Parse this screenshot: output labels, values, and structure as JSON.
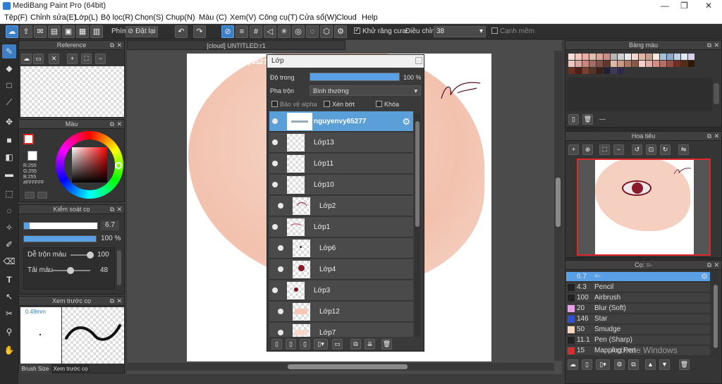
{
  "window": {
    "title": "MediBang Paint Pro (64bit)"
  },
  "menu": [
    "Tệp(F)",
    "Chỉnh sửa(E)",
    "Lớp(L)",
    "Bộ lọc(R)",
    "Chọn(S)",
    "Chụp(N)",
    "Màu (C)",
    "Xem(V)",
    "Công cụ(T)",
    "Cửa sổ(W)",
    "Cloud",
    "Help"
  ],
  "toolbar": {
    "key_label": "Phím",
    "reset_label": "Đặt lại",
    "antialias_label": "Khử răng cưa",
    "correction_label": "Điều chỉnh",
    "correction_value": "38",
    "soft_edge_label": "Cạnh mềm"
  },
  "reference": {
    "title": "Reference"
  },
  "color_panel": {
    "title": "Màu",
    "r": "R:255",
    "g": "G:255",
    "b": "B:255",
    "hex": "#FFFFFF"
  },
  "brush_control": {
    "title": "Kiểm soát cọ",
    "size": "6.7",
    "opacity": "100 %",
    "blend_label": "Dễ trộn màu",
    "blend_value": "100",
    "amount_label": "Tải màu",
    "amount_value": "48",
    "size_fraction": 0.08,
    "opacity_fraction": 1.0,
    "blend_fraction": 1.0,
    "amount_fraction": 0.48
  },
  "brush_preview": {
    "title": "Xem trước cọ",
    "size": "0.49mm",
    "tab1": "Brush Size",
    "tab2": "Xem trước cọ"
  },
  "document": {
    "tab": "[cloud] UNTITLED:r1",
    "watermark": "nguyenvy65277\nH0247"
  },
  "layers": {
    "title": "Lớp",
    "opacity_label": "Độ trong",
    "opacity_value": "100 %",
    "blend_label": "Pha trộn",
    "blend_value": "Bình thường",
    "protect_alpha": "Bảo vệ alpha",
    "clip": "Xén bớt",
    "lock": "Khóa",
    "items": [
      {
        "name": "nguyenvy65277",
        "selected": true,
        "indent": false
      },
      {
        "name": "Lớp13",
        "selected": false,
        "indent": false
      },
      {
        "name": "Lớp11",
        "selected": false,
        "indent": false
      },
      {
        "name": "Lớp10",
        "selected": false,
        "indent": false
      },
      {
        "name": "Lớp2",
        "selected": false,
        "indent": true
      },
      {
        "name": "Lớp1",
        "selected": false,
        "indent": false
      },
      {
        "name": "Lớp6",
        "selected": false,
        "indent": true
      },
      {
        "name": "Lớp4",
        "selected": false,
        "indent": true
      },
      {
        "name": "Lớp3",
        "selected": false,
        "indent": false
      },
      {
        "name": "Lớp12",
        "selected": false,
        "indent": true
      },
      {
        "name": "Lớp7",
        "selected": false,
        "indent": true
      }
    ]
  },
  "palette": {
    "title": "Bảng màu",
    "footer": "---"
  },
  "navigator": {
    "title": "Hoa tiêu"
  },
  "brushes": {
    "title": "Cọ: =-",
    "items": [
      {
        "size": "6.7",
        "name": "=-",
        "color": "#5aa0e6",
        "selected": true
      },
      {
        "size": "4.3",
        "name": "Pencil",
        "color": "#222222",
        "selected": false
      },
      {
        "size": "100",
        "name": "Airbrush",
        "color": "#222222",
        "selected": false
      },
      {
        "size": "20",
        "name": "Blur (Soft)",
        "color": "#e8a0e8",
        "selected": false
      },
      {
        "size": "146",
        "name": "Star",
        "color": "#3050d0",
        "selected": false
      },
      {
        "size": "50",
        "name": "Smudge",
        "color": "#f8d8c0",
        "selected": false
      },
      {
        "size": "11.1",
        "name": "Pen (Sharp)",
        "color": "#222222",
        "selected": false
      },
      {
        "size": "15",
        "name": "Mapping Pen",
        "color": "#d03030",
        "selected": false
      }
    ]
  },
  "watermark_os": "Activate Windows"
}
